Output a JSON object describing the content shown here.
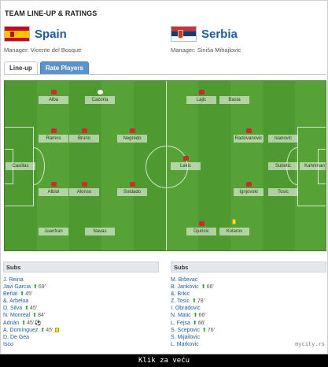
{
  "header": {
    "title": "TEAM LINE-UP & RATINGS"
  },
  "home": {
    "team": "Spain",
    "manager": "Manager: Vicente del Bosque",
    "players": [
      {
        "name": "Alba",
        "card": "",
        "ball": false
      },
      {
        "name": "Cazorla",
        "ball": true
      },
      {
        "name": "Ramos"
      },
      {
        "name": "Bruno"
      },
      {
        "name": "Negredo"
      },
      {
        "name": "Casillas"
      },
      {
        "name": "Albiol"
      },
      {
        "name": "Alonso"
      },
      {
        "name": "Soldado"
      },
      {
        "name": "Juanfran"
      },
      {
        "name": "Navas"
      }
    ],
    "subs_label": "Subs",
    "subs": [
      {
        "name": "J. Reina",
        "min": ""
      },
      {
        "name": "Javi Garcia",
        "min": "69'",
        "arrow": true
      },
      {
        "name": "Beñat",
        "min": "45'",
        "arrow": true
      },
      {
        "name": "&. Arbeloa",
        "min": ""
      },
      {
        "name": "D. Silva",
        "min": "45'",
        "arrow": true
      },
      {
        "name": "N. Monreal",
        "min": "84'",
        "arrow": true
      },
      {
        "name": "Adrián",
        "min": "45'",
        "arrow": true,
        "ball": true
      },
      {
        "name": "A. Domínguez",
        "min": "45'",
        "arrow": true,
        "card": "yellow"
      },
      {
        "name": "D. De Gea",
        "min": ""
      },
      {
        "name": "Isco",
        "min": ""
      }
    ]
  },
  "away": {
    "team": "Serbia",
    "manager": "Manager: Siniša Mihajlovic",
    "players": [
      {
        "name": "Lajic"
      },
      {
        "name": "Basta"
      },
      {
        "name": "Radovanovic"
      },
      {
        "name": "Ivanovic"
      },
      {
        "name": "Lekic"
      },
      {
        "name": "Subotic"
      },
      {
        "name": "Kahriman"
      },
      {
        "name": "Ignjovski"
      },
      {
        "name": "Tosic"
      },
      {
        "name": "Djuricic"
      },
      {
        "name": "Kolarov",
        "card": "yellow"
      }
    ],
    "subs_label": "Subs",
    "subs": [
      {
        "name": "M. Biševac",
        "min": ""
      },
      {
        "name": "B. Jankovic",
        "min": "66'",
        "arrow": true
      },
      {
        "name": "&. Brkic",
        "min": ""
      },
      {
        "name": "Z. Tosic",
        "min": "78'",
        "arrow": true
      },
      {
        "name": "I. Obradovic",
        "min": ""
      },
      {
        "name": "N. Matic",
        "min": "66'",
        "arrow": true
      },
      {
        "name": "L. Fejsa",
        "min": "66'",
        "arrow": true
      },
      {
        "name": "S. Scepovic",
        "min": "76'",
        "arrow": true
      },
      {
        "name": "S. Mijailovic",
        "min": ""
      },
      {
        "name": "L. Markovic",
        "min": ""
      }
    ]
  },
  "tabs": [
    {
      "label": "Line-up"
    },
    {
      "label": "Rate Players"
    }
  ],
  "watermark": "mycity.rs",
  "caption": "Klik za veću",
  "colors": {
    "pitch": "#4e9a30",
    "accent": "#1f5da0",
    "tab": "#5b93cc"
  }
}
